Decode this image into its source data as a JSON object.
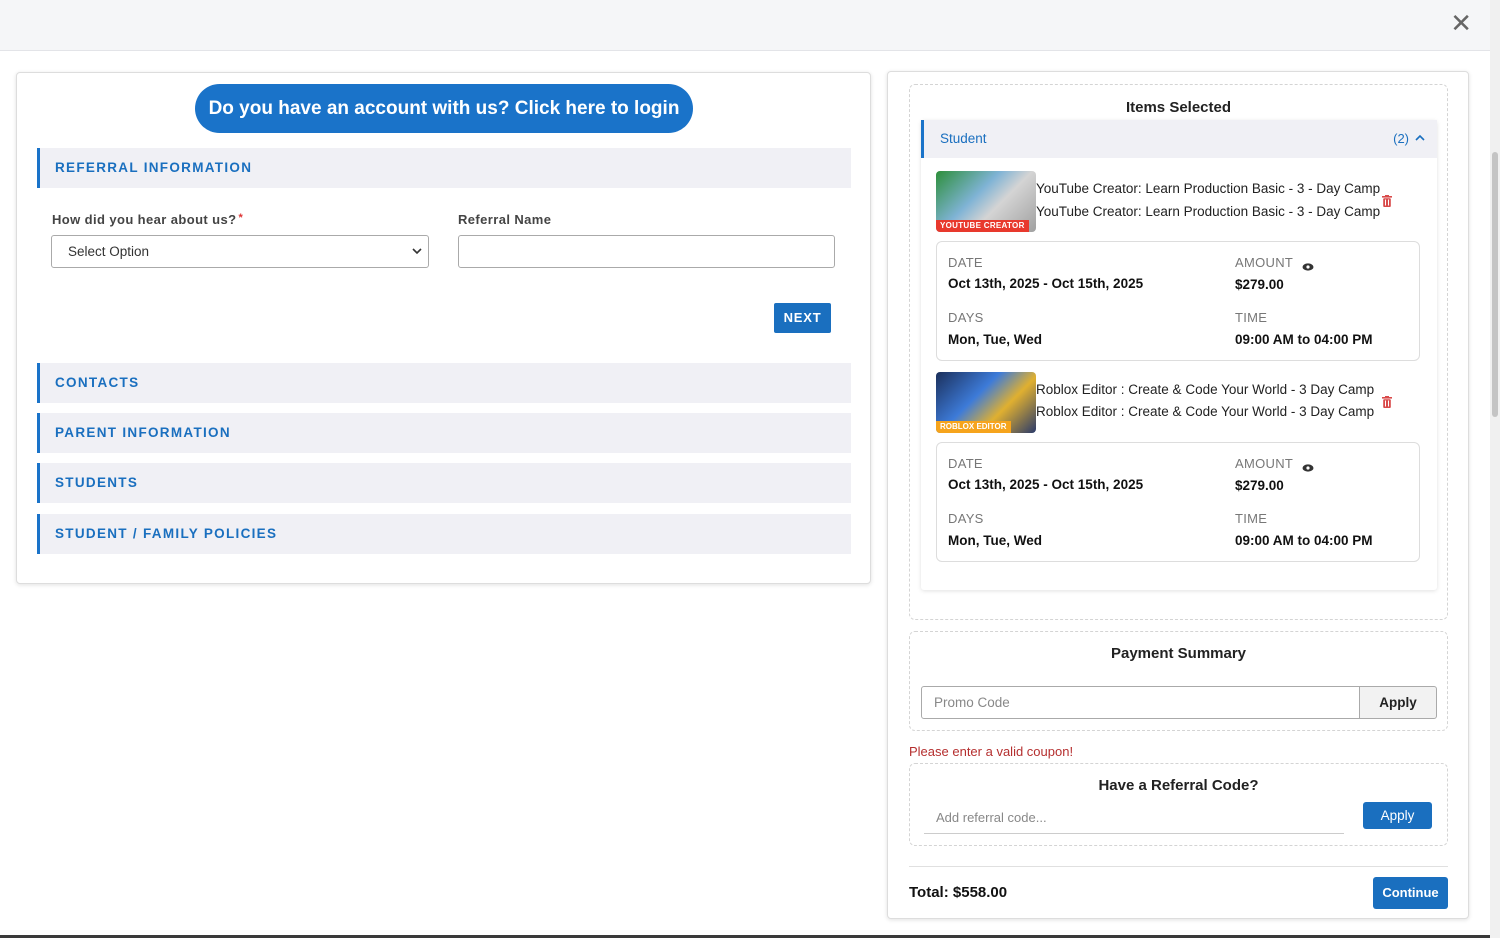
{
  "modal": {
    "close_icon": "close-icon",
    "close_glyph": "✕"
  },
  "left": {
    "login_button": "Do you have an account with us? Click here to login",
    "sections": {
      "referral": "REFERRAL INFORMATION",
      "contacts": "CONTACTS",
      "parent": "PARENT INFORMATION",
      "students": "STUDENTS",
      "policies": "STUDENT / FAMILY POLICIES"
    },
    "how_heard_label": "How did you hear about us?",
    "required_mark": "*",
    "how_heard_value": "Select Option",
    "referral_name_label": "Referral Name",
    "referral_name_value": "",
    "next_button": "NEXT"
  },
  "right": {
    "items_title": "Items Selected",
    "student_label": "Student",
    "student_count": "(2)",
    "items": [
      {
        "thumb_tag": "YOUTUBE CREATOR",
        "title_line1": "YouTube Creator: Learn Production Basic - 3 - Day Camp",
        "title_line2": "YouTube Creator: Learn Production Basic - 3 - Day Camp",
        "date_label": "DATE",
        "date_value": "Oct 13th, 2025 - Oct 15th, 2025",
        "amount_label": "AMOUNT",
        "amount_value": "$279.00",
        "days_label": "DAYS",
        "days_value": "Mon, Tue, Wed",
        "time_label": "TIME",
        "time_value": "09:00 AM to 04:00 PM"
      },
      {
        "thumb_tag": "ROBLOX EDITOR",
        "title_line1": "Roblox Editor : Create & Code Your World - 3 Day Camp",
        "title_line2": "Roblox Editor : Create & Code Your World - 3 Day Camp",
        "date_label": "DATE",
        "date_value": "Oct 13th, 2025 - Oct 15th, 2025",
        "amount_label": "AMOUNT",
        "amount_value": "$279.00",
        "days_label": "DAYS",
        "days_value": "Mon, Tue, Wed",
        "time_label": "TIME",
        "time_value": "09:00 AM to 04:00 PM"
      }
    ],
    "payment_title": "Payment Summary",
    "promo_placeholder": "Promo Code",
    "promo_apply": "Apply",
    "error_message": "Please enter a valid coupon!",
    "referral_title": "Have a Referral Code?",
    "referral_placeholder": "Add referral code...",
    "referral_apply": "Apply",
    "total": "Total: $558.00",
    "continue_button": "Continue"
  },
  "colors": {
    "accent": "#1a73c9",
    "error": "#b52f2f",
    "section_bg": "#f0f0f5"
  }
}
